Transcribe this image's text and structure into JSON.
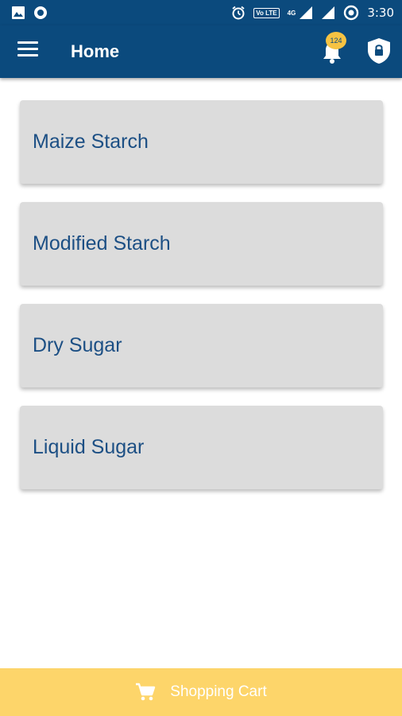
{
  "status_bar": {
    "time": "3:30",
    "volte": "Vo LTE",
    "network": "4G"
  },
  "app_bar": {
    "title": "Home",
    "notification_count": "124",
    "icons": [
      "menu-icon",
      "bell-icon",
      "shield-lock-icon"
    ]
  },
  "categories": [
    {
      "label": "Maize Starch"
    },
    {
      "label": "Modified Starch"
    },
    {
      "label": "Dry Sugar"
    },
    {
      "label": "Liquid Sugar"
    }
  ],
  "bottom_bar": {
    "label": "Shopping Cart",
    "icon": "cart-icon"
  },
  "colors": {
    "primary": "#0b4a7d",
    "card_bg": "#dcdcdc",
    "card_text": "#1c4f84",
    "badge": "#f6c343",
    "cart_bar": "#fdd56a"
  }
}
